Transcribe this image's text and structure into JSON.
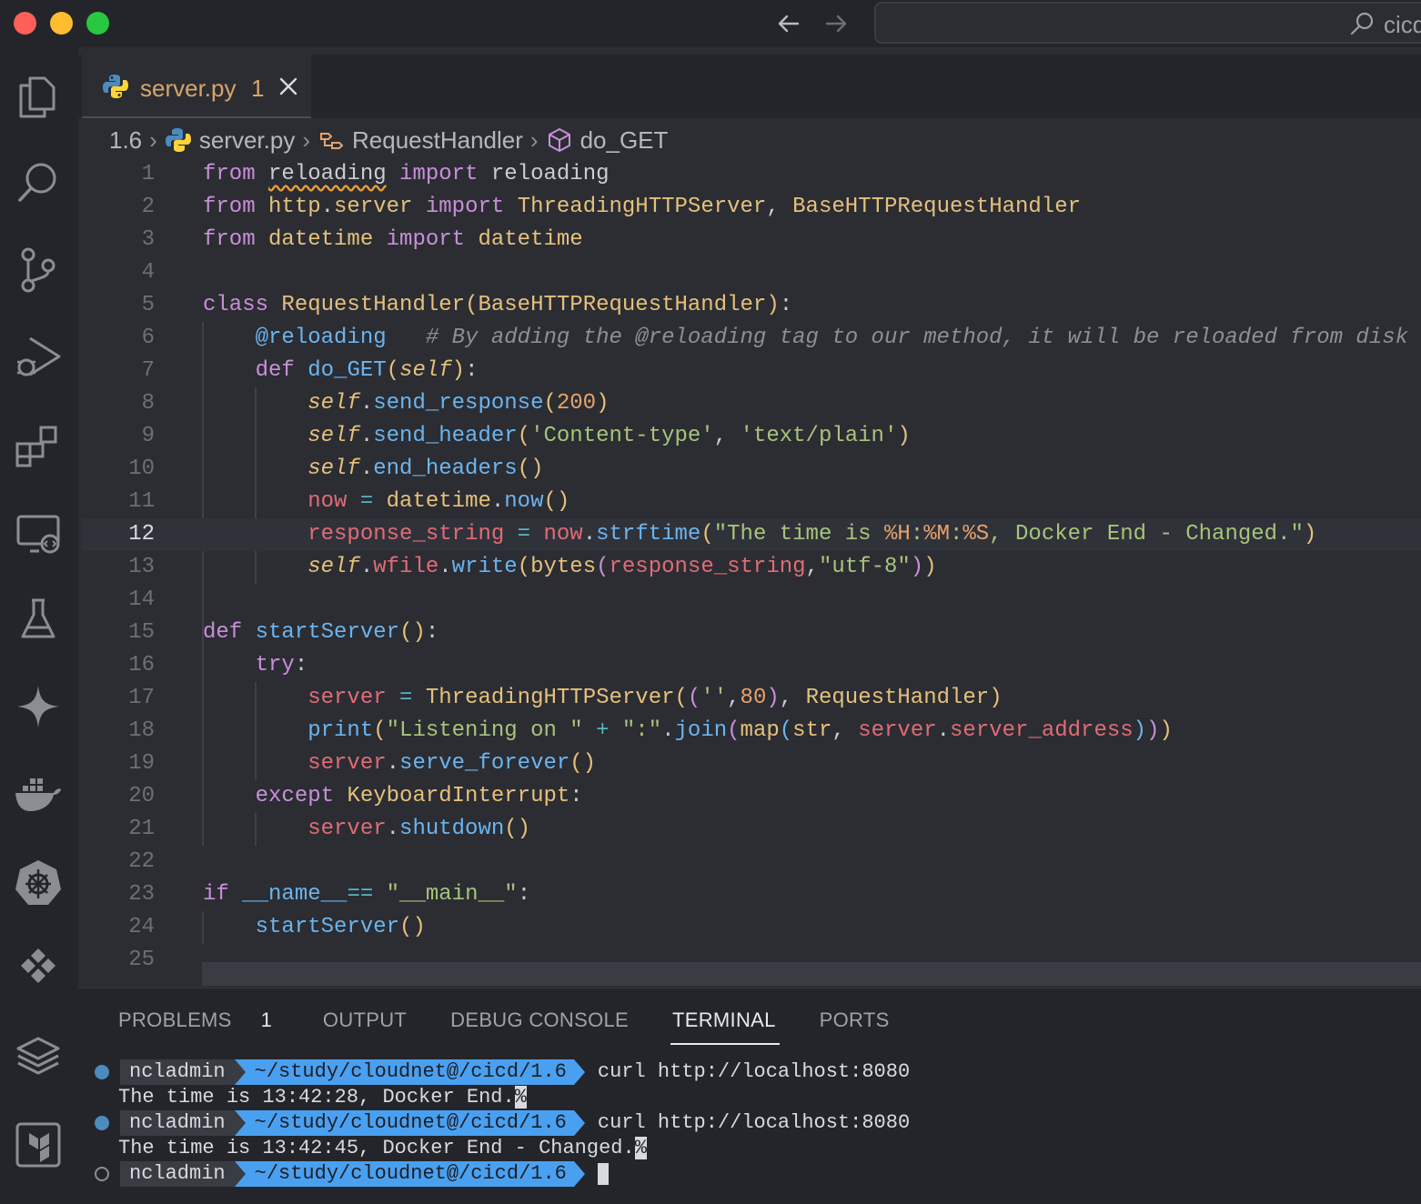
{
  "title_bar": {
    "command_center_text": "cicd"
  },
  "activity_bar": {
    "items": [
      "explorer-icon",
      "search-icon",
      "source-control-icon",
      "run-debug-icon",
      "extensions-icon",
      "remote-explorer-icon",
      "testing-icon",
      "copilot-icon",
      "docker-icon",
      "kubernetes-icon",
      "layout-icon",
      "layers-icon",
      "terraform-icon"
    ]
  },
  "tab": {
    "label": "server.py",
    "badge": "1"
  },
  "breadcrumb": {
    "folder": "1.6",
    "file": "server.py",
    "class": "RequestHandler",
    "method": "do_GET"
  },
  "editor": {
    "active_line": 12,
    "line_numbers": [
      "1",
      "2",
      "3",
      "4",
      "5",
      "6",
      "7",
      "8",
      "9",
      "10",
      "11",
      "12",
      "13",
      "14",
      "15",
      "16",
      "17",
      "18",
      "19",
      "20",
      "21",
      "22",
      "23",
      "24",
      "25"
    ]
  },
  "panel": {
    "tabs": {
      "problems": "PROBLEMS",
      "problems_count": "1",
      "output": "OUTPUT",
      "debug_console": "DEBUG CONSOLE",
      "terminal": "TERMINAL",
      "ports": "PORTS"
    },
    "terminal": {
      "user": "ncladmin",
      "path": "~/study/cloudnet@/cicd/1.6",
      "command1": "curl http://localhost:8080",
      "output1": "The time is 13:42:28, Docker End.",
      "command2": "curl http://localhost:8080",
      "output2": "The time is 13:42:45, Docker End - Changed.",
      "percent": "%"
    }
  },
  "colors": {
    "background": "#2b2d33",
    "tab_label": "#d9a46a",
    "keyword": "#c98fd9",
    "function": "#6cb4ee",
    "string": "#a7c47a",
    "terminal_path_bg": "#4aa0f0"
  }
}
